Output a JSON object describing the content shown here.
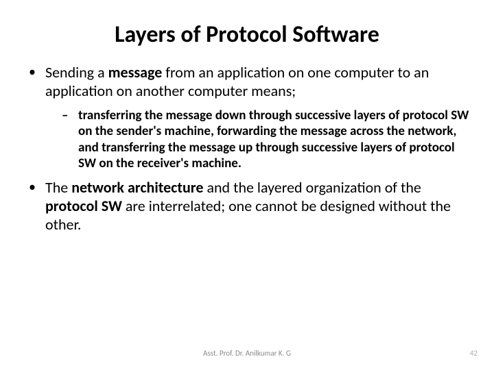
{
  "title": "Layers of Protocol Software",
  "bullet1": {
    "pre": "Sending a ",
    "bold": "message",
    "post": " from an application on one computer to an application on another computer means;"
  },
  "sub1": {
    "s1b": "transferring the message down through successive layers of protocol SW on the sender's machine",
    "s1c": ", ",
    "s2b": "forwarding the message across the network",
    "s2c": ", and ",
    "s3b": "transferring the message up through successive layers of protocol SW on the receiver's machine",
    "s3c": "."
  },
  "bullet2": {
    "p1": "The ",
    "b1": "network architecture",
    "p2": " and the layered organization of the ",
    "b2": "protocol SW",
    "p3": " are interrelated; one cannot be designed without the other."
  },
  "footer": "Asst. Prof. Dr. Anilkumar K. G",
  "page": "42"
}
